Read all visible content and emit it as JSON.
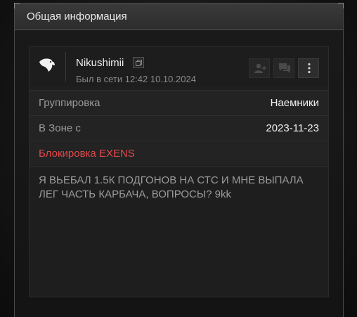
{
  "panel": {
    "title": "Общая информация"
  },
  "profile": {
    "nickname": "Nikushimii",
    "last_seen": "Был в сети 12:42 10.10.2024",
    "icons": {
      "logo": "eagle-logo-icon",
      "copy": "copy-icon",
      "add_friend": "add-friend-icon",
      "message": "message-icon",
      "more": "more-vertical-icon"
    }
  },
  "fields": [
    {
      "label": "Группировка",
      "value": "Наемники"
    },
    {
      "label": "В Зоне с",
      "value": "2023-11-23"
    }
  ],
  "ban": {
    "label": "Блокировка EXENS",
    "color": "#e0484b"
  },
  "status": {
    "text": "Я ВЬЕБАЛ 1.5К ПОДГОНОВ НА СТС И МНЕ ВЫПАЛА ЛЕГ ЧАСТЬ КАРБАЧА, ВОПРОСЫ? 9kk"
  }
}
